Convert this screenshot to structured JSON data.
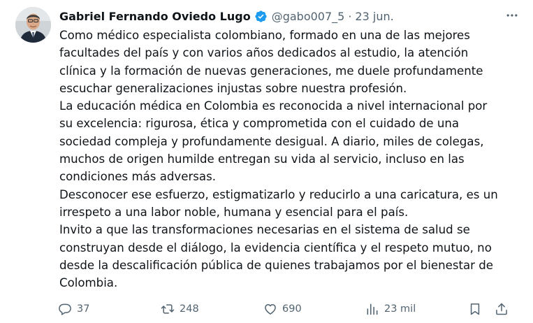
{
  "author": {
    "name": "Gabriel Fernando Oviedo Lugo",
    "handle": "@gabo007_5",
    "separator": "·",
    "date": "23 jun."
  },
  "icons": {
    "verified": "verified-badge-icon",
    "more": "more-options-icon",
    "reply": "reply-icon",
    "repost": "repost-icon",
    "like": "like-icon",
    "views": "views-icon",
    "bookmark": "bookmark-icon",
    "share": "share-icon"
  },
  "colors": {
    "verified": "#1d9bf0",
    "secondary_text": "#536471",
    "primary_text": "#0f1419"
  },
  "tweet": {
    "lines": [
      "Como médico especialista colombiano, formado en una de las mejores",
      "facultades del país y con varios años dedicados al estudio, la atención",
      "clínica y la formación de nuevas generaciones, me duele profundamente",
      "escuchar generalizaciones injustas sobre nuestra profesión.",
      "La educación médica en Colombia es reconocida a nivel internacional por",
      "su excelencia: rigurosa, ética y comprometida con el cuidado de una",
      "sociedad compleja y profundamente desigual. A diario, miles de colegas,",
      "muchos de origen humilde entregan su vida al servicio, incluso en las",
      "condiciones más adversas.",
      "Desconocer ese esfuerzo, estigmatizarlo y reducirlo a una caricatura, es un",
      "irrespeto a una labor noble, humana y esencial para el país.",
      "Invito a que las transformaciones necesarias en el sistema de salud se",
      "construyan desde el diálogo, la evidencia científica y el respeto mutuo, no",
      "desde la descalificación pública de quienes trabajamos por el bienestar de",
      "Colombia."
    ]
  },
  "stats": {
    "replies": "37",
    "reposts": "248",
    "likes": "690",
    "views": "23 mil"
  }
}
